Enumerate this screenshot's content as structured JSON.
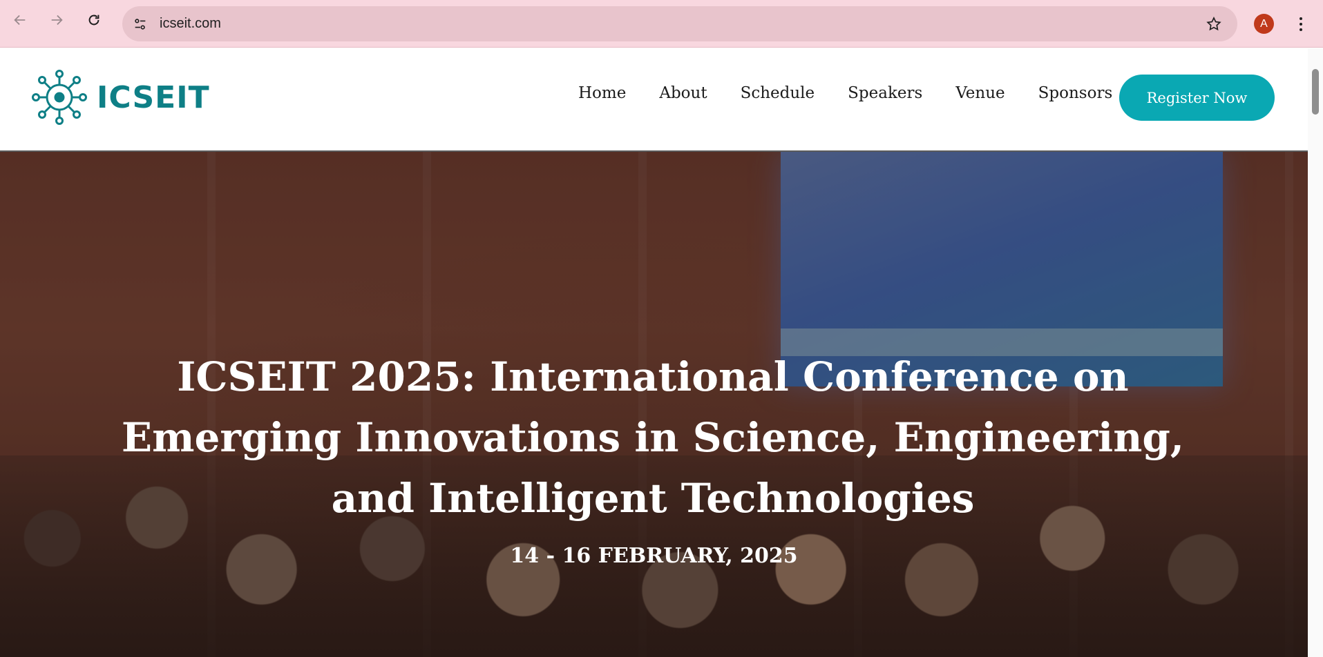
{
  "browser": {
    "url": "icseit.com",
    "profile_initial": "A",
    "colors": {
      "toolbar": "#f8d7df",
      "omnibox": "#e8c4cc",
      "avatar": "#c0391b"
    }
  },
  "site": {
    "logo_text": "ICSEIT",
    "nav": [
      "Home",
      "About",
      "Schedule",
      "Speakers",
      "Venue",
      "Sponsors"
    ],
    "register_label": "Register Now",
    "colors": {
      "brand": "#0e7f86",
      "button": "#0aa8b3"
    }
  },
  "hero": {
    "title": "ICSEIT 2025: International Conference on Emerging Innovations in Science, Engineering, and Intelligent Technologies",
    "date": "14 - 16 FEBRUARY, 2025"
  }
}
